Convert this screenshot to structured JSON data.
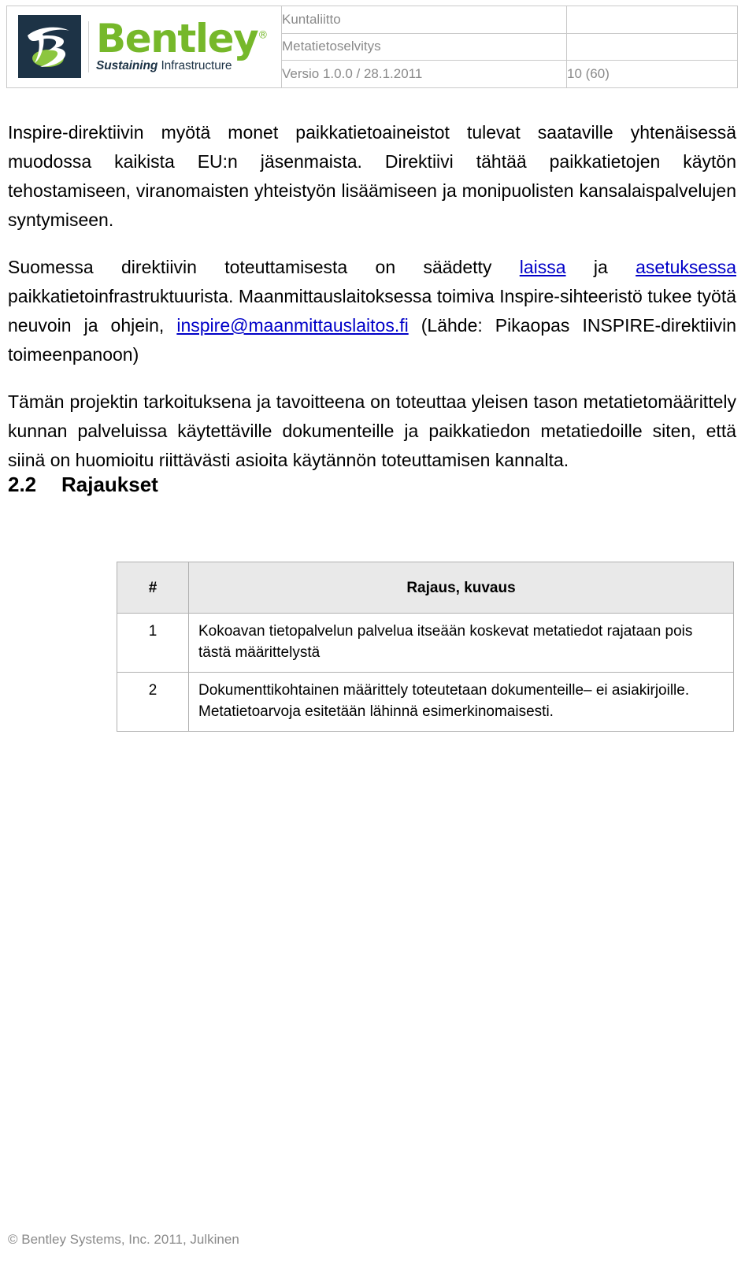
{
  "header": {
    "logo": {
      "brand": "Bentley",
      "registered_mark": "®",
      "tagline_bold": "Sustaining",
      "tagline_regular": "Infrastructure",
      "mark_bg_color": "#1d3346",
      "brand_color": "#76b82a",
      "accent_green": "#8cc63f"
    },
    "rows": [
      {
        "label": "Kuntaliitto",
        "right": ""
      },
      {
        "label": "Metatietoselvitys",
        "right": ""
      },
      {
        "label": "Versio 1.0.0 / 28.1.2011",
        "right": "10 (60)"
      }
    ]
  },
  "body": {
    "paragraph1": "Inspire-direktiivin myötä monet paikkatietoaineistot tulevat saataville yhtenäisessä muodossa kaikista EU:n jäsenmaista. Direktiivi tähtää paikkatietojen käytön tehostamiseen, viranomaisten yhteistyön lisäämiseen ja monipuolisten kansalaispalvelujen syntymiseen.",
    "paragraph2": {
      "part1": "Suomessa direktiivin toteuttamisesta on säädetty ",
      "link1": "laissa",
      "part2": " ja ",
      "link2": "asetuksessa",
      "part3": " paikkatietoinfrastruktuurista. Maanmittauslaitoksessa toimiva Inspire-sihteeristö tukee työtä neuvoin ja ohjein, ",
      "link3": "inspire@maanmittauslaitos.fi",
      "part4": " (Lähde: Pikaopas INSPIRE-direktiivin toimeenpanoon)",
      "link_color": "#0000c8"
    },
    "paragraph3": "Tämän projektin tarkoituksena ja tavoitteena on toteuttaa yleisen tason metatietomäärittely kunnan palveluissa käytettäville dokumenteille ja paikkatiedon metatiedoille siten, että siinä on huomioitu riittävästi asioita käytännön toteuttamisen kannalta."
  },
  "heading": {
    "number": "2.2",
    "title": "Rajaukset"
  },
  "rajaus_table": {
    "columns": [
      "#",
      "Rajaus, kuvaus"
    ],
    "header_bg": "#e9e9e9",
    "rows": [
      {
        "num": "1",
        "desc": "Kokoavan tietopalvelun palvelua itseään koskevat metatiedot rajataan pois tästä määrittelystä"
      },
      {
        "num": "2",
        "desc": "Dokumenttikohtainen määrittely toteutetaan dokumenteille– ei asiakirjoille. Metatietoarvoja esitetään lähinnä esimerkinomaisesti."
      }
    ]
  },
  "footer": {
    "text": "© Bentley Systems, Inc. 2011, Julkinen"
  }
}
